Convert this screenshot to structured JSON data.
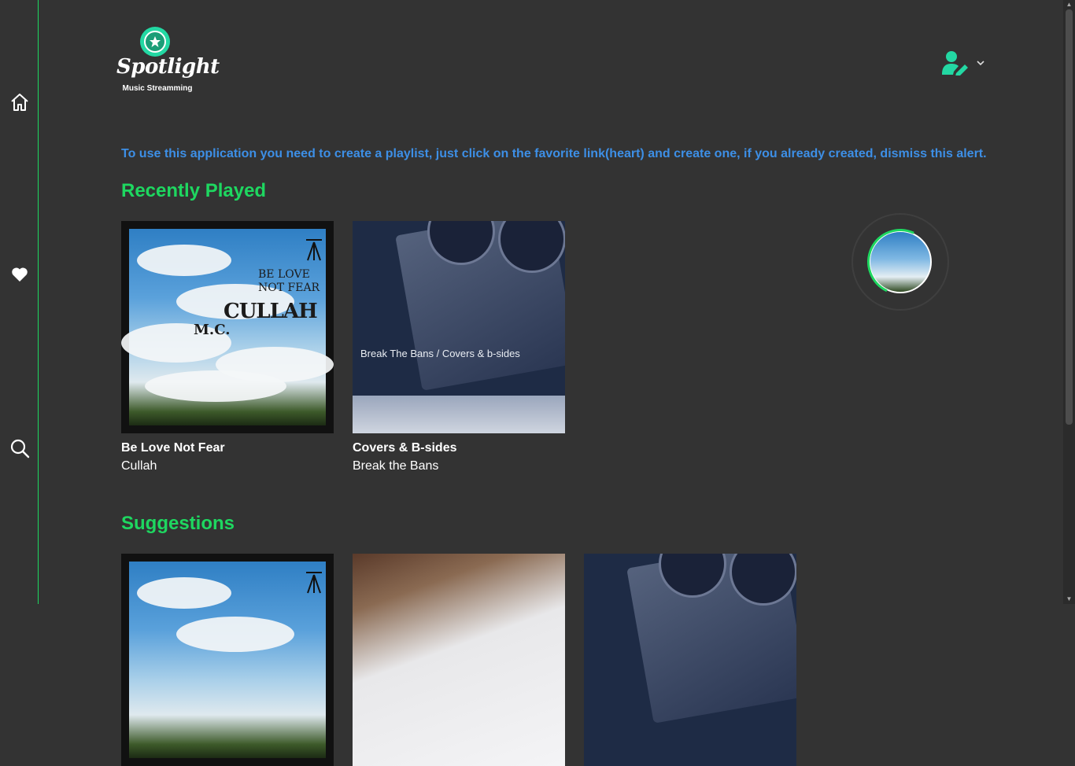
{
  "logo": {
    "name": "Spotlight",
    "tagline": "Music Streamming"
  },
  "alert": {
    "text": "To use this application you need to create a playlist, just click on the favorite link(heart) and create one, if you already created, dismiss this alert."
  },
  "sections": {
    "recent_title": "Recently Played",
    "suggestions_title": "Suggestions"
  },
  "recent": [
    {
      "title": "Be Love Not Fear",
      "artist": "Cullah"
    },
    {
      "title": "Covers & B-sides",
      "artist": "Break the Bans"
    }
  ],
  "covers": {
    "sky_line1": "BE LOVE",
    "sky_line2": "NOT FEAR",
    "sky_band": "CULLAH",
    "sky_prefix": "M.C.",
    "tape_caption": "Break The Bans / Covers & b-sides"
  },
  "icons": {
    "home": "home-icon",
    "favorites": "heart-icon",
    "search": "search-icon",
    "user": "user-edit-icon",
    "dropdown": "chevron-down-icon"
  },
  "colors": {
    "background": "#333333",
    "accent": "#1ed760",
    "alert": "#3d8fe6",
    "logo_badge": "#23d8a3"
  }
}
